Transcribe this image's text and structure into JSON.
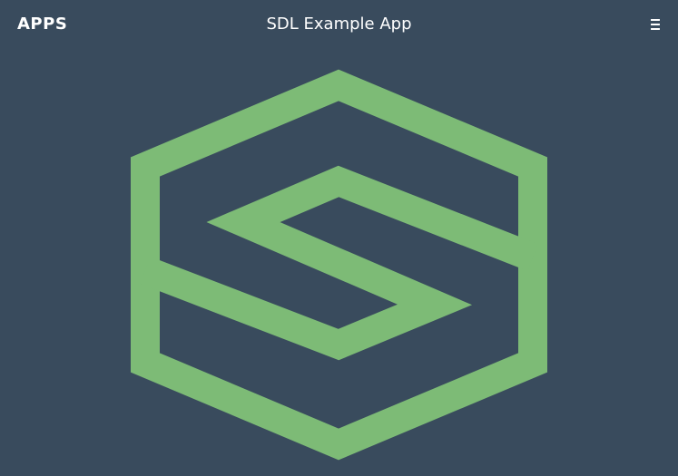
{
  "colors": {
    "background": "#394b5d",
    "accent": "#7dbb76",
    "text": "#ffffff"
  },
  "header": {
    "apps_label": "APPS",
    "title": "SDL Example App",
    "menu_icon": "hamburger-menu-icon"
  },
  "logo": {
    "icon": "sdl-logo-icon"
  }
}
